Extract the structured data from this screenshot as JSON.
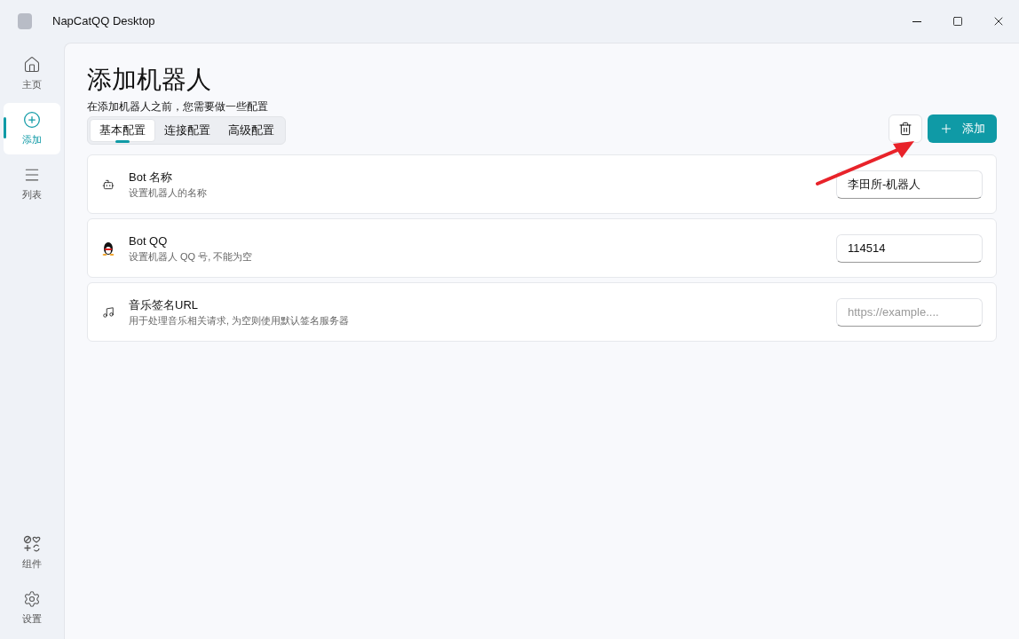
{
  "window": {
    "title": "NapCatQQ Desktop"
  },
  "sidebar": {
    "items": [
      {
        "label": "主页",
        "selected": false
      },
      {
        "label": "添加",
        "selected": true
      },
      {
        "label": "列表",
        "selected": false
      }
    ],
    "bottom_items": [
      {
        "label": "组件",
        "selected": false
      },
      {
        "label": "设置",
        "selected": false
      }
    ]
  },
  "page": {
    "title": "添加机器人",
    "subtitle": "在添加机器人之前，您需要做一些配置",
    "tabs": [
      {
        "label": "基本配置",
        "selected": true
      },
      {
        "label": "连接配置",
        "selected": false
      },
      {
        "label": "高级配置",
        "selected": false
      }
    ],
    "add_button": "添加",
    "settings": [
      {
        "title": "Bot 名称",
        "description": "设置机器人的名称",
        "value": "李田所-机器人"
      },
      {
        "title": "Bot QQ",
        "description": "设置机器人 QQ 号, 不能为空",
        "value": "114514"
      },
      {
        "title": "音乐签名URL",
        "description": "用于处理音乐相关请求, 为空则使用默认签名服务器",
        "placeholder": "https://example...."
      }
    ]
  }
}
